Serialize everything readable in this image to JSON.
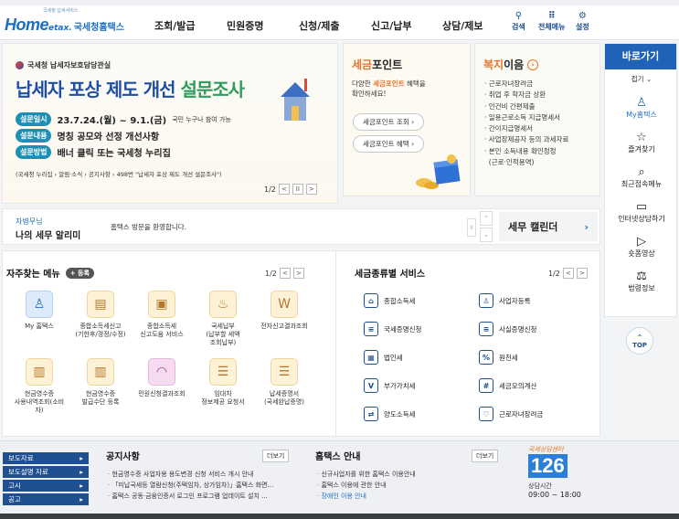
{
  "header": {
    "logo_text": "Home",
    "logo_sub": "국세청홈택스",
    "logo_small": "국세청 납세서비스",
    "menu": [
      "조회/발급",
      "민원증명",
      "신청/제출",
      "신고/납부",
      "상담/제보"
    ],
    "icons": [
      {
        "icon": "search-icon",
        "label": "검색"
      },
      {
        "icon": "grid-menu-icon",
        "label": "전체메뉴"
      },
      {
        "icon": "gear-icon",
        "label": "설정"
      }
    ]
  },
  "banner": {
    "org": "국세청 납세자보호담당관실",
    "title_part1": "납세자 포상 제도 개선",
    "title_part2": "설문조사",
    "rows": [
      {
        "tag": "설문일시",
        "text": "23.7.24.(월) ~ 9.1.(금)",
        "extra": "국민 누구나 참여 가능"
      },
      {
        "tag": "설문내용",
        "text": "명칭 공모와 선정 개선사항",
        "extra": ""
      },
      {
        "tag": "설문방법",
        "text": "배너 클릭 또는 국세청 누리집",
        "extra": ""
      }
    ],
    "note": "(국세청 누리집 › 알림·소식 › 공지사항 › 498번 \"납세자 포상 제도 개선 설문조사\")",
    "pager": "1/2"
  },
  "tax_point": {
    "title_accent": "세금",
    "title_rest": "포인트",
    "desc_pre": "다양한 ",
    "desc_accent": "세금포인트",
    "desc_post": " 혜택을",
    "desc_line2": "확인하세요!",
    "btn1": "세금포인트 조회",
    "btn2": "세금포인트 혜택"
  },
  "welfare": {
    "title_accent": "복지",
    "title_rest": "이음",
    "items": [
      "근로자녀장려금",
      "취업 후 학자금 상환",
      "인건비 간편제출",
      "일용근로소득 지급명세서",
      "간이지급명세서",
      "사업장제공자 등의 과세자료",
      "본인 소득내용 확인정정",
      "(근로·인적용역)"
    ]
  },
  "quick_side": {
    "title": "바로가기",
    "fold": "접기",
    "items": [
      {
        "icon": "person-icon",
        "label": "My홈택스"
      },
      {
        "icon": "star-icon",
        "label": "즐겨찾기"
      },
      {
        "icon": "recent-menu-icon",
        "label": "최근접속메뉴"
      },
      {
        "icon": "monitor-chat-icon",
        "label": "인터넷상담하기"
      },
      {
        "icon": "play-icon",
        "label": "숏폼영상"
      },
      {
        "icon": "gavel-icon",
        "label": "법령정보"
      }
    ],
    "top": "TOP"
  },
  "notice": {
    "user": "자병무님",
    "title": "나의 세무 알리미",
    "message": "홈택스 방문을 환영합니다.",
    "calendar": "세무 캘린더"
  },
  "favorites": {
    "title": "자주찾는 메뉴",
    "add": "등록",
    "pager": "1/2",
    "tiles": [
      {
        "icon": "person-icon",
        "label": "My 홈택스",
        "color": "#dceaf9"
      },
      {
        "icon": "calendar-icon",
        "label": "종합소득세신고\n(기한후/경정/수정)",
        "color": "#fdf1d6"
      },
      {
        "icon": "calendar-check-icon",
        "label": "종합소득세\n신고도움 서비스",
        "color": "#fdf1d6"
      },
      {
        "icon": "money-bag-icon",
        "label": "국세납부\n(납부할 세액\n조회납부)",
        "color": "#fdf1d6"
      },
      {
        "icon": "document-w-icon",
        "label": "전자신고결과조회",
        "color": "#fdf1d6"
      },
      {
        "icon": "receipt-card-icon",
        "label": "현금영수증\n사용내역조회(소비\n자)",
        "color": "#fdf1d6"
      },
      {
        "icon": "receipt-icon",
        "label": "현금영수증\n발급수단 등록",
        "color": "#fdf1d6"
      },
      {
        "icon": "headset-icon",
        "label": "민원신청결과조회",
        "color": "#f6dcf0"
      },
      {
        "icon": "doc-list-icon",
        "label": "임대차\n정보제공 요청서",
        "color": "#fdf1d6"
      },
      {
        "icon": "doc-check-icon",
        "label": "납세증명서\n(국세완납증명)",
        "color": "#fdf1d6"
      }
    ]
  },
  "tax_services": {
    "title": "세금종류별 서비스",
    "pager": "1/2",
    "items": [
      {
        "icon": "house-money-icon",
        "label": "종합소득세"
      },
      {
        "icon": "person-reg-icon",
        "label": "사업자등록"
      },
      {
        "icon": "document-icon",
        "label": "국세증명신청"
      },
      {
        "icon": "document-icon",
        "label": "사실증명신청"
      },
      {
        "icon": "building-icon",
        "label": "법인세"
      },
      {
        "icon": "percent-doc-icon",
        "label": "원천세"
      },
      {
        "icon": "vat-icon",
        "label": "부가가치세"
      },
      {
        "icon": "calculator-icon",
        "label": "세금모의계산"
      },
      {
        "icon": "transfer-icon",
        "label": "양도소득세"
      },
      {
        "icon": "heart-hand-icon",
        "label": "근로자녀장려금"
      }
    ]
  },
  "footer": {
    "links": [
      "보도자료",
      "보도설명 자료",
      "고시",
      "공고"
    ],
    "notice_title": "공지사항",
    "notice_more": "더보기",
    "notice_items": [
      "현금영수증 사업자용 용도변경 신청 서비스 개시 안내",
      "「미납국세등 열람신청(주택임차, 상가임차)」홈택스 화면...",
      "홈택스 공동·금융인증서 로그인 프로그램 업데이트 설치 ..."
    ],
    "guide_title": "홈택스 안내",
    "guide_more": "더보기",
    "guide_items": [
      "신규사업자를 위한 홈택스 이용안내",
      "홈택스 이용에 관한 안내",
      "장애인 이용 안내"
    ],
    "callcenter_label": "국세상담센터",
    "callcenter_number": "126",
    "hours_label": "상담시간",
    "hours": "09:00 ~ 18:00"
  }
}
